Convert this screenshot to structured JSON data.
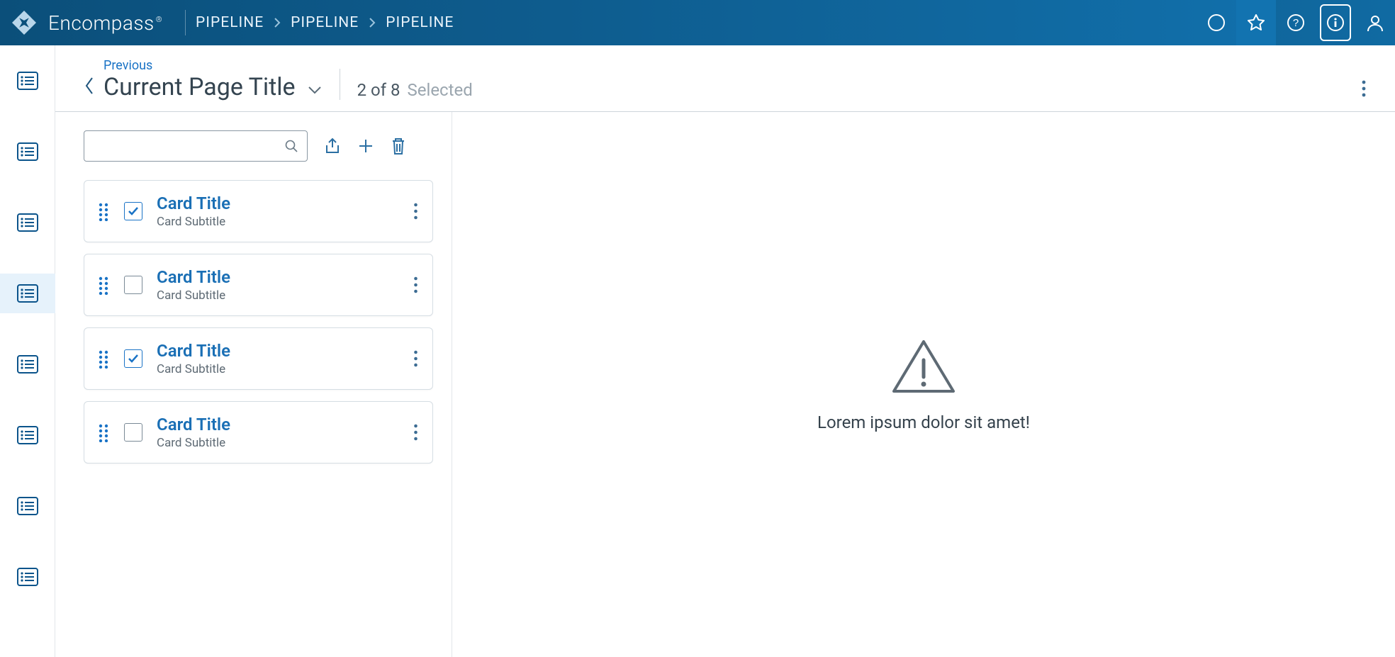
{
  "brand": {
    "name": "Encompass"
  },
  "breadcrumbs": [
    "PIPELINE",
    "PIPELINE",
    "PIPELINE"
  ],
  "header": {
    "previous_label": "Previous",
    "title": "Current Page Title",
    "count": "2 of 8",
    "count_label": "Selected"
  },
  "rail": {
    "items": [
      {
        "selected": false
      },
      {
        "selected": false
      },
      {
        "selected": false
      },
      {
        "selected": true
      },
      {
        "selected": false
      },
      {
        "selected": false
      },
      {
        "selected": false
      },
      {
        "selected": false
      }
    ]
  },
  "search": {
    "placeholder": ""
  },
  "cards": [
    {
      "title": "Card Title",
      "subtitle": "Card Subtitle",
      "checked": true
    },
    {
      "title": "Card Title",
      "subtitle": "Card Subtitle",
      "checked": false
    },
    {
      "title": "Card Title",
      "subtitle": "Card Subtitle",
      "checked": true
    },
    {
      "title": "Card Title",
      "subtitle": "Card Subtitle",
      "checked": false
    }
  ],
  "empty": {
    "message": "Lorem ipsum dolor sit amet!"
  }
}
